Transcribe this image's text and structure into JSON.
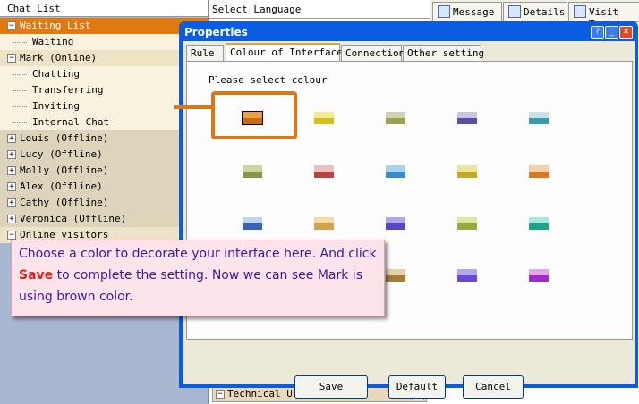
{
  "chat_list": {
    "header": "Chat List",
    "items": [
      {
        "label": "Waiting List",
        "expander": "−",
        "type": "root",
        "selected": true
      },
      {
        "label": "Waiting",
        "type": "child"
      },
      {
        "label": "Mark (Online)",
        "expander": "−",
        "type": "root"
      },
      {
        "label": "Chatting",
        "type": "child"
      },
      {
        "label": "Transferring",
        "type": "child"
      },
      {
        "label": "Inviting",
        "type": "child"
      },
      {
        "label": "Internal Chat",
        "type": "child"
      },
      {
        "label": "Louis (Offline)",
        "expander": "+",
        "type": "root"
      },
      {
        "label": "Lucy (Offline)",
        "expander": "+",
        "type": "root"
      },
      {
        "label": "Molly (Offline)",
        "expander": "+",
        "type": "root"
      },
      {
        "label": "Alex (Offline)",
        "expander": "+",
        "type": "root"
      },
      {
        "label": "Cathy (Offline)",
        "expander": "+",
        "type": "root"
      },
      {
        "label": "Veronica (Offline)",
        "expander": "+",
        "type": "root"
      },
      {
        "label": "Online visitors",
        "expander": "−",
        "type": "root"
      }
    ]
  },
  "middle": {
    "select_language": "Select Language",
    "technical_use": "Technical Use",
    "expander": "−",
    "dropdown_glyph": "∨"
  },
  "right_tabs": [
    {
      "label": "Message",
      "icon": "message-icon"
    },
    {
      "label": "Details",
      "icon": "details-icon"
    },
    {
      "label": "Visit Tra",
      "icon": "visit-icon"
    }
  ],
  "dialog": {
    "title": "Properties",
    "title_buttons": {
      "help": "?",
      "minimize": "_",
      "close": "✕"
    },
    "tabs": [
      "Rule",
      "Colour of Interface",
      "Connection",
      "Other setting"
    ],
    "active_tab": "Colour of Interface",
    "instruction": "Please select colour",
    "swatches": [
      {
        "top": "#eea040",
        "bottom": "#c86a10",
        "selected": true
      },
      {
        "top": "#f2ec90",
        "bottom": "#d2c01c"
      },
      {
        "top": "#d2d2b0",
        "bottom": "#9ca050"
      },
      {
        "top": "#c8c4e4",
        "bottom": "#5c4ca0"
      },
      {
        "top": "#c8e2ea",
        "bottom": "#3a9aa8"
      },
      {
        "top": "#d0d2a0",
        "bottom": "#8a9446"
      },
      {
        "top": "#eec0c0",
        "bottom": "#b84444"
      },
      {
        "top": "#aad4ee",
        "bottom": "#3a8ccc"
      },
      {
        "top": "#eee49a",
        "bottom": "#c4aa20"
      },
      {
        "top": "#f4d0a4",
        "bottom": "#d87824"
      },
      {
        "top": "#bcd4ee",
        "bottom": "#3862b4"
      },
      {
        "top": "#f4dca4",
        "bottom": "#d4a448"
      },
      {
        "top": "#b0a8ee",
        "bottom": "#5a44c8"
      },
      {
        "top": "#dae8a0",
        "bottom": "#94aa3a"
      },
      {
        "top": "#a0ecd8",
        "bottom": "#1aa48a"
      },
      {
        "top": "#e8ccd4",
        "bottom": "#a06070"
      },
      {
        "top": "#f4a4a4",
        "bottom": "#d42020"
      },
      {
        "top": "#e8d0a8",
        "bottom": "#a87c30"
      },
      {
        "top": "#b0a8f4",
        "bottom": "#6a48e0"
      },
      {
        "top": "#e4a4f0",
        "bottom": "#a428c8"
      }
    ],
    "buttons": {
      "save": "Save",
      "default": "Default",
      "cancel": "Cancel"
    }
  },
  "callout": {
    "text_1": "Choose a color to decorate your interface here. And click ",
    "highlight": "Save",
    "text_2": " to complete the setting. Now we can see Mark is using brown color."
  },
  "colors": {
    "selection_bar": "#e07a10",
    "highlight_box": "#d8781a",
    "title_bar": "#0a5ce0"
  }
}
